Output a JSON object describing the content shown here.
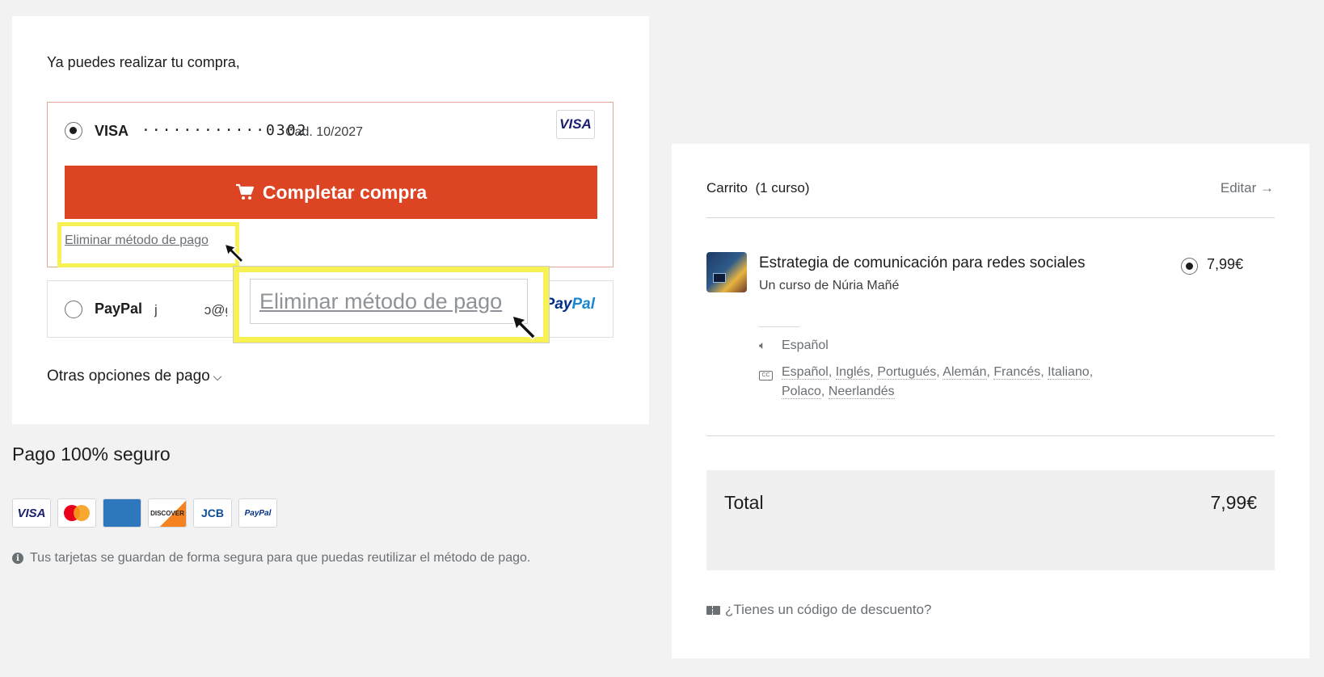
{
  "payment": {
    "intro": "Ya puedes realizar tu compra,",
    "visa": {
      "brand": "VISA",
      "number": "············0302",
      "expiry": "Cad. 10/2027",
      "logo": "VISA"
    },
    "complete_button": "Completar compra",
    "remove_link": "Eliminar método de pago",
    "zoom_label": "Eliminar método de pago",
    "paypal": {
      "name": "PayPal",
      "email_prefix": "j",
      "email_suffix": "ɔ@gı",
      "logo_p": "Pay",
      "logo_rest": "Pal"
    },
    "other_options": "Otras opciones de pago"
  },
  "secure": {
    "title": "Pago 100% seguro",
    "logos": [
      "VISA",
      "mastercard",
      "AMERICAN EXPRESS",
      "DISCOVER",
      "JCB",
      "PayPal"
    ],
    "note": "Tus tarjetas se guardan de forma segura para que puedas reutilizar el método de pago."
  },
  "cart": {
    "title": "Carrito  (1 curso)",
    "edit": "Editar →",
    "course": {
      "title": "Estrategia de comunicación para redes sociales",
      "author": "Un curso de Núria Mañé",
      "price": "7,99€",
      "audio": "Español",
      "subtitles": [
        "Español",
        "Inglés",
        "Portugués",
        "Alemán",
        "Francés",
        "Italiano",
        "Polaco",
        "Neerlandés"
      ]
    },
    "total_label": "Total",
    "total_value": "7,99€",
    "discount": "¿Tienes un código de descuento?"
  },
  "colors": {
    "accent": "#dd4424",
    "highlight": "#f7f154",
    "background": "#f2f2f2"
  }
}
